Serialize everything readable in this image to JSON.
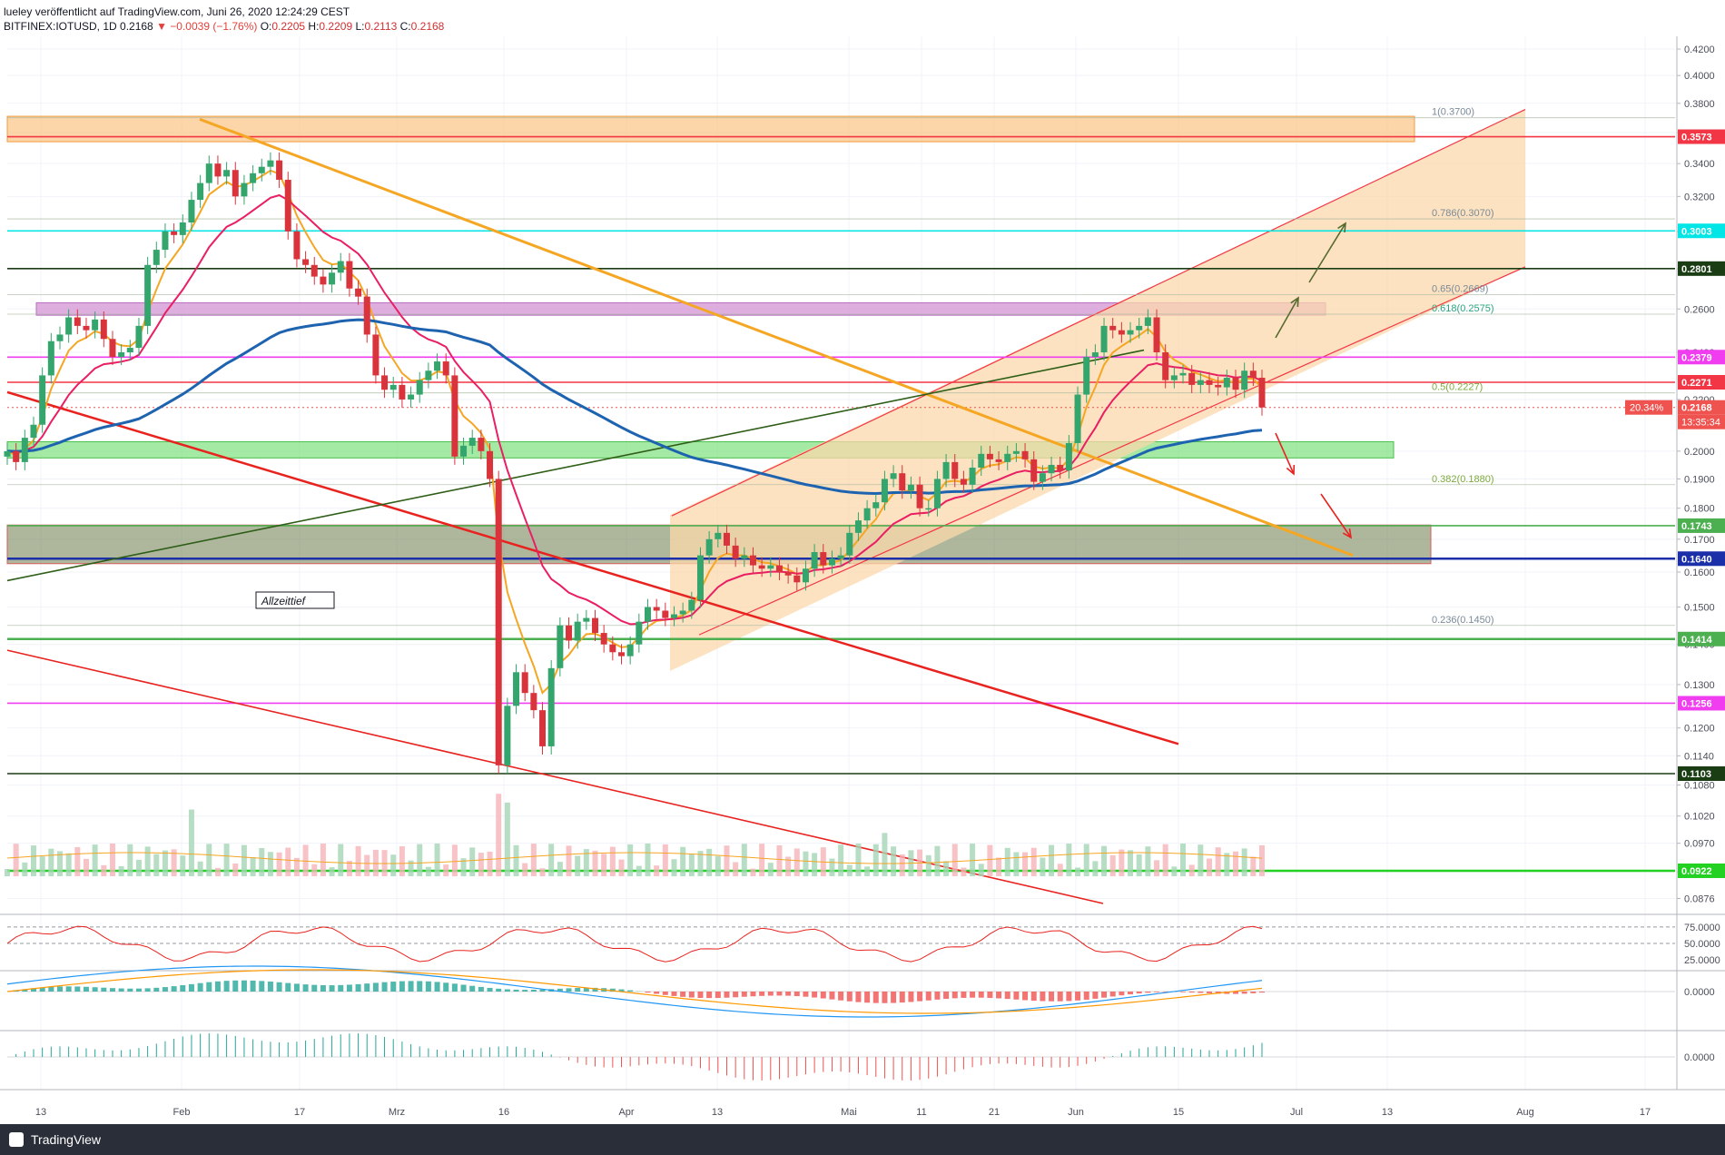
{
  "header": {
    "line1": "lueley veröffentlicht auf TradingView.com, Juni 26, 2020 12:24:29 CEST",
    "symbol": "BITFINEX:IOTUSD, 1D",
    "last": "0.2168",
    "change": "▼ −0.0039 (−1.76%)",
    "o_label": "O:",
    "o": "0.2205",
    "h_label": "H:",
    "h": "0.2209",
    "l_label": "L:",
    "l": "0.2113",
    "c_label": "C:",
    "c": "0.2168"
  },
  "footer": {
    "brand": "TradingView"
  },
  "colors": {
    "up": "#26a69a",
    "down": "#ef5350",
    "ema_orange": "#f5a623",
    "ema_pink": "#e91e63",
    "ma_blue": "#1e63b0",
    "band_orange": "#fbcb92",
    "band_green": "#7ee07e",
    "band_olive": "#6b7c4a",
    "band_purple": "#d59ad6"
  },
  "chart_data": [
    {
      "type": "candlestick",
      "title": "",
      "x_ticks": [
        "13",
        "Feb",
        "17",
        "Mrz",
        "16",
        "Apr",
        "13",
        "Mai",
        "11",
        "21",
        "Jun",
        "15",
        "Jul",
        "13",
        "Aug",
        "17"
      ],
      "y_ticks": [
        "0.4200",
        "0.4000",
        "0.3800",
        "0.3600",
        "0.3400",
        "0.3200",
        "0.3000",
        "0.2800",
        "0.2600",
        "0.2400",
        "0.2200",
        "0.2000",
        "0.1900",
        "0.1800",
        "0.1700",
        "0.1600",
        "0.1500",
        "0.1400",
        "0.1300",
        "0.1200",
        "0.1140",
        "0.1080",
        "0.1020",
        "0.0970",
        "0.0920",
        "0.0876"
      ],
      "ylim": [
        0.0855,
        0.43
      ],
      "y_scale": "log",
      "price_closes": [
        0.2,
        0.196,
        0.205,
        0.21,
        0.23,
        0.245,
        0.248,
        0.256,
        0.252,
        0.25,
        0.255,
        0.246,
        0.238,
        0.24,
        0.242,
        0.252,
        0.282,
        0.29,
        0.3,
        0.298,
        0.305,
        0.318,
        0.328,
        0.34,
        0.332,
        0.336,
        0.32,
        0.328,
        0.334,
        0.338,
        0.342,
        0.33,
        0.3,
        0.285,
        0.282,
        0.276,
        0.272,
        0.278,
        0.284,
        0.27,
        0.266,
        0.248,
        0.23,
        0.224,
        0.226,
        0.22,
        0.222,
        0.228,
        0.232,
        0.236,
        0.23,
        0.198,
        0.202,
        0.205,
        0.2,
        0.19,
        0.112,
        0.125,
        0.133,
        0.128,
        0.124,
        0.116,
        0.134,
        0.145,
        0.141,
        0.146,
        0.147,
        0.143,
        0.14,
        0.138,
        0.137,
        0.14,
        0.146,
        0.15,
        0.149,
        0.147,
        0.148,
        0.149,
        0.152,
        0.165,
        0.17,
        0.172,
        0.168,
        0.164,
        0.165,
        0.162,
        0.161,
        0.162,
        0.16,
        0.159,
        0.157,
        0.161,
        0.166,
        0.162,
        0.164,
        0.165,
        0.172,
        0.176,
        0.18,
        0.182,
        0.19,
        0.192,
        0.186,
        0.188,
        0.18,
        0.18,
        0.19,
        0.196,
        0.19,
        0.188,
        0.194,
        0.199,
        0.197,
        0.196,
        0.199,
        0.2,
        0.197,
        0.189,
        0.192,
        0.195,
        0.193,
        0.203,
        0.222,
        0.238,
        0.24,
        0.252,
        0.25,
        0.248,
        0.25,
        0.252,
        0.256,
        0.24,
        0.228,
        0.23,
        0.231,
        0.226,
        0.228,
        0.226,
        0.225,
        0.229,
        0.224,
        0.232,
        0.229,
        0.2168
      ],
      "levels": [
        {
          "value": 0.3573,
          "label": "0.3573",
          "color": "#f23645"
        },
        {
          "value": 0.3003,
          "label": "0.3003",
          "color": "#00e5e5"
        },
        {
          "value": 0.2801,
          "label": "0.2801",
          "color": "#1b3d14"
        },
        {
          "value": 0.2379,
          "label": "0.2379",
          "color": "#f13df0"
        },
        {
          "value": 0.2271,
          "label": "0.2271",
          "color": "#f23645"
        },
        {
          "value": 0.2168,
          "label": "0.2168",
          "color": "#ef5350"
        },
        {
          "value": 0.1743,
          "label": "0.1743",
          "color": "#4caf50"
        },
        {
          "value": 0.164,
          "label": "0.1640",
          "color": "#1b2fa8"
        },
        {
          "value": 0.1414,
          "label": "0.1414",
          "color": "#4caf50"
        },
        {
          "value": 0.1256,
          "label": "0.1256",
          "color": "#f13df0"
        },
        {
          "value": 0.1103,
          "label": "0.1103",
          "color": "#1b3d14"
        },
        {
          "value": 0.0922,
          "label": "0.0922",
          "color": "#22d122"
        }
      ],
      "fib": [
        {
          "value": 0.37,
          "label": "1(0.3700)"
        },
        {
          "value": 0.307,
          "label": "0.786(0.3070)"
        },
        {
          "value": 0.2669,
          "label": "0.65(0.2669)"
        },
        {
          "value": 0.2575,
          "label": "0.618(0.2575)"
        },
        {
          "value": 0.2227,
          "label": "0.5(0.2227)"
        },
        {
          "value": 0.188,
          "label": "0.382(0.1880)"
        },
        {
          "value": 0.145,
          "label": "0.236(0.1450)"
        }
      ],
      "annotation": "Allzeittief",
      "price_badge": "20.34%",
      "countdown": "13:35:34"
    },
    {
      "type": "line",
      "title": "",
      "y_ticks": [
        "75.0000",
        "50.0000",
        "25.0000"
      ],
      "ylim": [
        10,
        90
      ]
    },
    {
      "type": "bar",
      "title": "",
      "y_ticks": [
        "0.0000"
      ]
    },
    {
      "type": "bar",
      "title": "",
      "y_ticks": [
        "0.0000"
      ]
    }
  ]
}
